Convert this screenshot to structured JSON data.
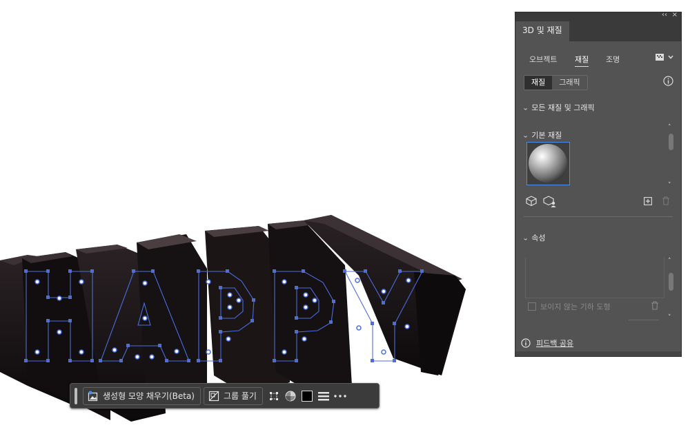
{
  "canvas": {
    "letters": [
      "H",
      "A",
      "P",
      "P",
      "Y"
    ],
    "selection_color": "#4a6ee0"
  },
  "taskbar": {
    "generative_fill_label": "생성형 모양 채우기(Beta)",
    "ungroup_label": "그룹 풀기",
    "fill_color": "#000000"
  },
  "panel": {
    "title": "3D 및 재질",
    "tabs": [
      "오브젝트",
      "재질",
      "조명"
    ],
    "active_tab": "재질",
    "segment": [
      "재질",
      "그래픽"
    ],
    "all_materials_header": "모든 재질 및 그래픽",
    "base_material_header": "기본 재질",
    "properties_header": "속성",
    "invisible_geometry_label": "보이지 않는 기하 도형",
    "feedback_label": "피드백 공유"
  }
}
